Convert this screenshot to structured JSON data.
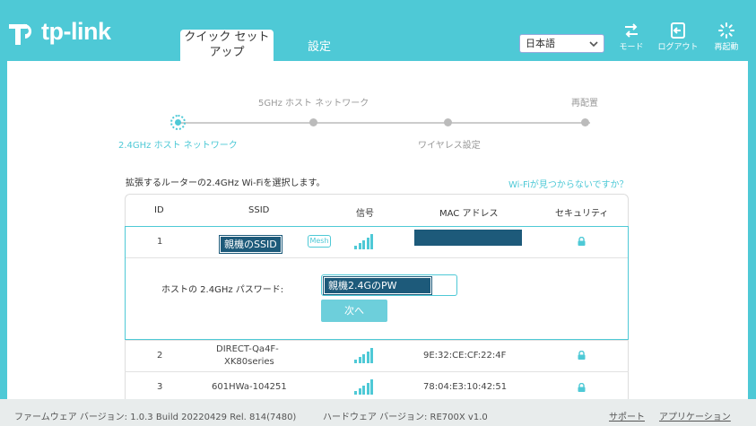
{
  "header": {
    "brand": "tp-link",
    "tabs": [
      "クイック セット",
      "アップ",
      "設定"
    ],
    "language": "日本語",
    "buttons": [
      {
        "label": "モード",
        "icon": "mode-icon"
      },
      {
        "label": "ログアウト",
        "icon": "logout-icon"
      },
      {
        "label": "再起動",
        "icon": "reboot-icon"
      }
    ]
  },
  "stepper": {
    "step1": "2.4GHz ホスト ネットワーク",
    "step2": "5GHz ホスト ネットワーク",
    "step3": "ワイヤレス設定",
    "step4": "再配置"
  },
  "main": {
    "instruction": "拡張するルーターの2.4GHz Wi-Fiを選択します。",
    "not_found_link": "Wi-Fiが見つからないですか？"
  },
  "table": {
    "headers": {
      "id": "ID",
      "ssid": "SSID",
      "signal": "信号",
      "mac": "MAC アドレス",
      "security": "セキュリティ"
    },
    "rows": [
      {
        "id": "1",
        "ssid": "親機のSSID",
        "tag": "Mesh",
        "mac": ""
      },
      {
        "id": "2",
        "ssid_line1": "DIRECT-Qa4F-",
        "ssid_line2": "XK80series",
        "mac": "9E:32:CE:CF:22:4F"
      },
      {
        "id": "3",
        "ssid": "601HWa-104251",
        "mac": "78:04:E3:10:42:51"
      }
    ]
  },
  "password": {
    "label": "ホストの 2.4GHz パスワード:",
    "value": "親機2.4GのPW",
    "next_button": "次へ"
  },
  "footer": {
    "firmware": "ファームウェア バージョン: 1.0.3 Build 20220429 Rel. 814(7480)",
    "hardware": "ハードウェア バージョン: RE700X v1.0",
    "support": "サポート",
    "app": "アプリケーション"
  },
  "colors": {
    "accent": "#4ec9d6",
    "redact": "#1d5a7a"
  }
}
